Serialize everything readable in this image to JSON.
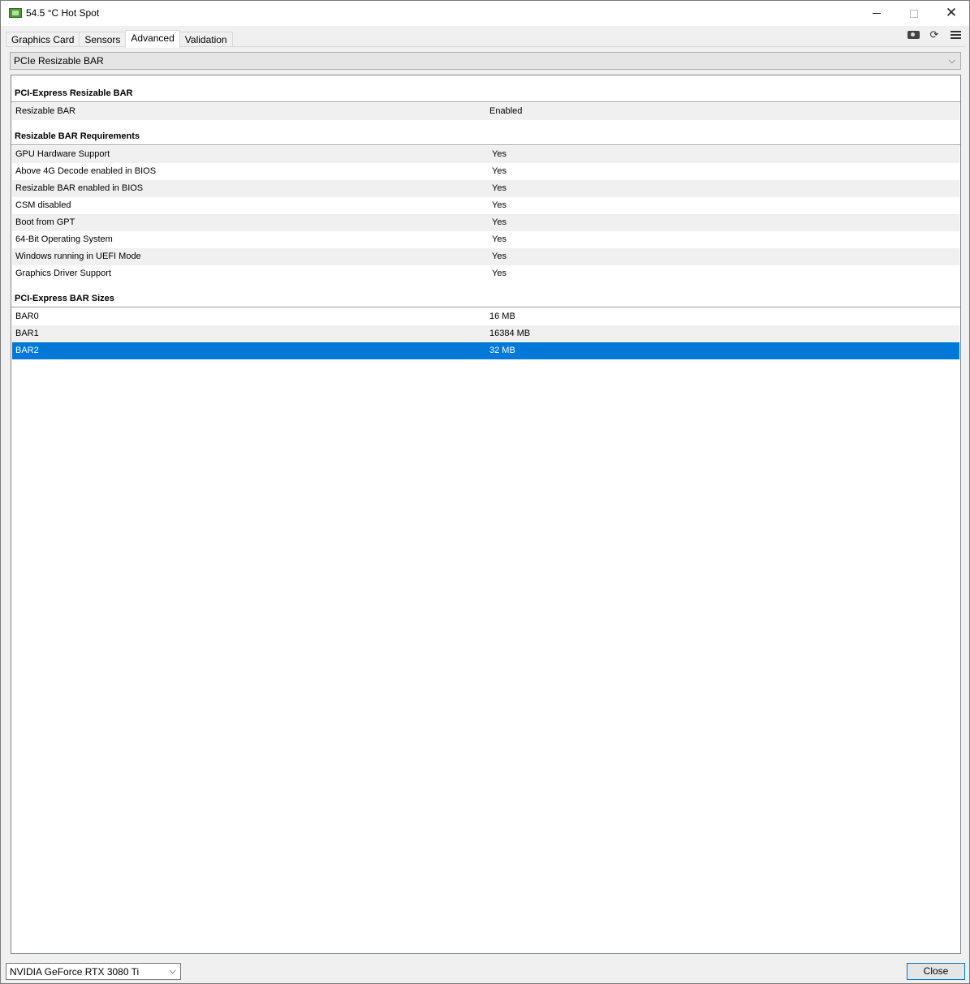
{
  "window": {
    "title": "54.5 °C Hot Spot",
    "minimize_glyph": "",
    "close_glyph": "✕"
  },
  "tabs": [
    {
      "label": "Graphics Card",
      "active": false
    },
    {
      "label": "Sensors",
      "active": false
    },
    {
      "label": "Advanced",
      "active": true
    },
    {
      "label": "Validation",
      "active": false
    }
  ],
  "toolbar": {
    "icons": [
      "camera-icon",
      "refresh-icon",
      "menu-icon"
    ],
    "refresh_glyph": "⟳"
  },
  "section_select": {
    "value": "PCIe Resizable BAR",
    "chevron": "⌵"
  },
  "groups": [
    {
      "header": "PCI-Express Resizable BAR",
      "rows": [
        {
          "label": "Resizable BAR",
          "value": "Enabled"
        }
      ]
    },
    {
      "header": "Resizable BAR Requirements",
      "rows": [
        {
          "label": "GPU Hardware Support",
          "value": "Yes"
        },
        {
          "label": "Above 4G Decode enabled in BIOS",
          "value": "Yes"
        },
        {
          "label": "Resizable BAR enabled in BIOS",
          "value": "Yes"
        },
        {
          "label": "CSM disabled",
          "value": "Yes"
        },
        {
          "label": "Boot from GPT",
          "value": "Yes"
        },
        {
          "label": "64-Bit Operating System",
          "value": "Yes"
        },
        {
          "label": "Windows running in UEFI Mode",
          "value": "Yes"
        },
        {
          "label": "Graphics Driver Support",
          "value": "Yes"
        }
      ]
    },
    {
      "header": "PCI-Express BAR Sizes",
      "rows": [
        {
          "label": "BAR0",
          "value": "16 MB"
        },
        {
          "label": "BAR1",
          "value": "16384 MB"
        },
        {
          "label": "BAR2",
          "value": "32 MB",
          "selected": true
        }
      ]
    }
  ],
  "footer": {
    "gpu_select": "NVIDIA GeForce RTX 3080 Ti",
    "gpu_chevron": "⌵",
    "close_label": "Close"
  },
  "colors": {
    "selection": "#0078d7",
    "alt_row": "#f0f0f0"
  }
}
